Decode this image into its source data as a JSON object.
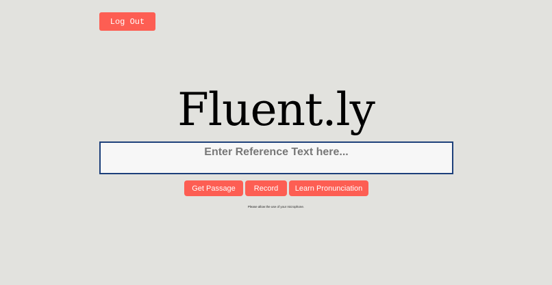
{
  "header": {
    "logout_label": "Log Out"
  },
  "main": {
    "title": "Fluent.ly",
    "reference_input": {
      "value": "",
      "placeholder": "Enter Reference Text here..."
    },
    "buttons": {
      "get_passage": "Get Passage",
      "record": "Record",
      "learn_pronunciation": "Learn Pronunciation"
    },
    "mic_notice": "Please allow the use of your microphone."
  },
  "colors": {
    "background": "#e2e2de",
    "accent": "#fd5e53",
    "input_border": "#1c3f7a"
  }
}
